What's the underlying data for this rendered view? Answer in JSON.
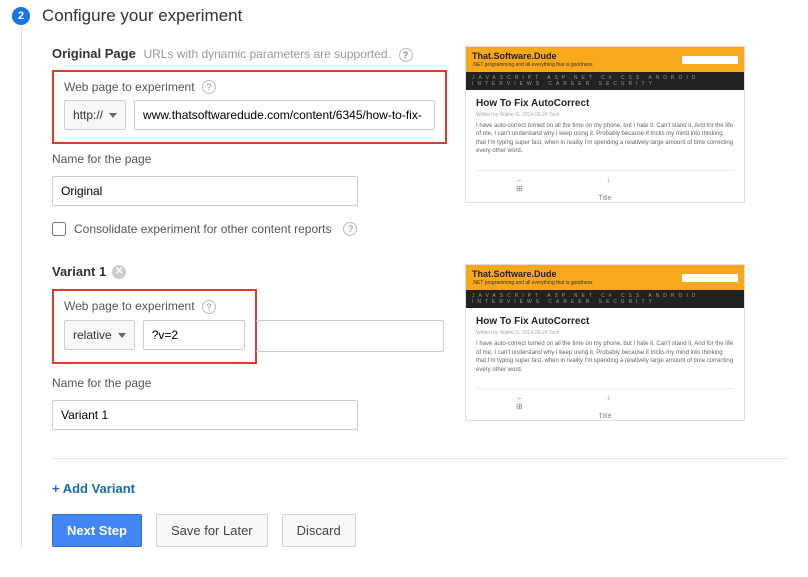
{
  "step": {
    "number": "2",
    "title": "Configure your experiment"
  },
  "original": {
    "heading": "Original Page",
    "hint": "URLs with dynamic parameters are supported.",
    "url_label": "Web page to experiment",
    "protocol_selected": "http://",
    "url_value": "www.thatsoftwaredude.com/content/6345/how-to-fix-",
    "name_label": "Name for the page",
    "name_value": "Original",
    "consolidate_label": "Consolidate experiment for other content reports"
  },
  "variant1": {
    "heading": "Variant 1",
    "url_label": "Web page to experiment",
    "protocol_selected": "relative",
    "url_value": "?v=2",
    "name_label": "Name for the page",
    "name_value": "Variant 1"
  },
  "links": {
    "add_variant": "+ Add Variant"
  },
  "buttons": {
    "next": "Next Step",
    "save": "Save for Later",
    "discard": "Discard"
  },
  "preview": {
    "brand": "That.Software.Dude",
    "tagline": ".NET programming and all everything that is goodness",
    "title": "How To Fix AutoCorrect",
    "meta": "Written by Walter G.  2014-06-24  Tech",
    "para": "I have auto-correct turned on all the time on my phone, but I hate it. Can't stand it. And for the life of me, I can't understand why I keep using it. Probably because it tricks my mind into thinking that I'm typing super fast, when in reality I'm spending a relatively large amount of time correcting every other word.",
    "foot_title": "Title"
  }
}
